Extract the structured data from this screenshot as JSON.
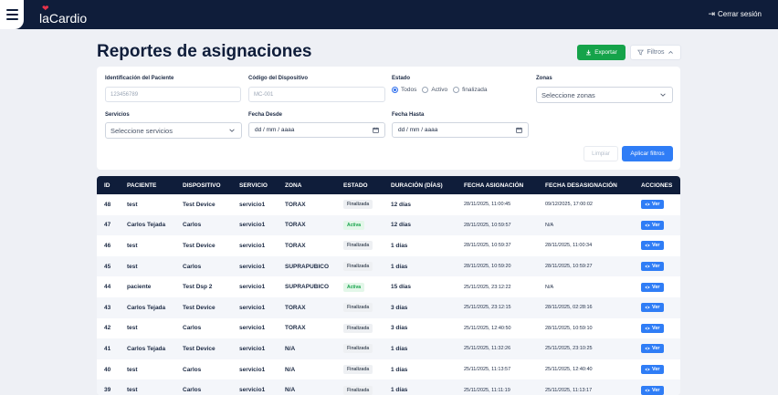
{
  "app": {
    "logo_text": "laCardio",
    "logout_label": "Cerrar sesión"
  },
  "page": {
    "title": "Reportes de asignaciones",
    "export_label": "Exportar",
    "filters_label": "Filtros"
  },
  "filters": {
    "patient_id": {
      "label": "Identificación del Paciente",
      "placeholder": "123456789"
    },
    "device_code": {
      "label": "Código del Dispositivo",
      "placeholder": "MC-001"
    },
    "status": {
      "label": "Estado",
      "options": [
        "Todos",
        "Activo",
        "finalizada"
      ],
      "selected": "Todos"
    },
    "zones": {
      "label": "Zonas",
      "value": "Seleccione zonas"
    },
    "services": {
      "label": "Servicios",
      "value": "Seleccione servicios"
    },
    "date_from": {
      "label": "Fecha Desde",
      "value": "dd / mm / aaaa"
    },
    "date_to": {
      "label": "Fecha Hasta",
      "value": "dd / mm / aaaa"
    },
    "clear_label": "Limpiar",
    "apply_label": "Aplicar filtros"
  },
  "table": {
    "headers": [
      "ID",
      "PACIENTE",
      "DISPOSITIVO",
      "SERVICIO",
      "ZONA",
      "ESTADO",
      "DURACIÓN (DÍAS)",
      "FECHA ASIGNACIÓN",
      "FECHA DESASIGNACIÓN",
      "ACCIONES"
    ],
    "action_label": "Ver",
    "rows": [
      {
        "id": "48",
        "patient": "test",
        "device": "Test Device",
        "service": "servicio1",
        "zone": "TORAX",
        "status": "Finalizada",
        "duration": "12 días",
        "assigned": "28/11/2025, 11:00:45",
        "unassigned": "09/12/2025, 17:00:02"
      },
      {
        "id": "47",
        "patient": "Carlos Tejada",
        "device": "Carlos",
        "service": "servicio1",
        "zone": "TORAX",
        "status": "Activa",
        "duration": "12 días",
        "assigned": "28/11/2025, 10:59:57",
        "unassigned": "N/A"
      },
      {
        "id": "46",
        "patient": "test",
        "device": "Test Device",
        "service": "servicio1",
        "zone": "TORAX",
        "status": "Finalizada",
        "duration": "1 días",
        "assigned": "28/11/2025, 10:59:37",
        "unassigned": "28/11/2025, 11:00:34"
      },
      {
        "id": "45",
        "patient": "test",
        "device": "Carlos",
        "service": "servicio1",
        "zone": "SUPRAPUBICO",
        "status": "Finalizada",
        "duration": "1 días",
        "assigned": "28/11/2025, 10:59:20",
        "unassigned": "28/11/2025, 10:59:27"
      },
      {
        "id": "44",
        "patient": "paciente",
        "device": "Test Dsp 2",
        "service": "servicio1",
        "zone": "SUPRAPUBICO",
        "status": "Activa",
        "duration": "15 días",
        "assigned": "25/11/2025, 23:12:22",
        "unassigned": "N/A"
      },
      {
        "id": "43",
        "patient": "Carlos Tejada",
        "device": "Test Device",
        "service": "servicio1",
        "zone": "TORAX",
        "status": "Finalizada",
        "duration": "3 días",
        "assigned": "25/11/2025, 23:12:15",
        "unassigned": "28/11/2025, 02:28:16"
      },
      {
        "id": "42",
        "patient": "test",
        "device": "Carlos",
        "service": "servicio1",
        "zone": "TORAX",
        "status": "Finalizada",
        "duration": "3 días",
        "assigned": "25/11/2025, 12:40:50",
        "unassigned": "28/11/2025, 10:59:10"
      },
      {
        "id": "41",
        "patient": "Carlos Tejada",
        "device": "Test Device",
        "service": "servicio1",
        "zone": "N/A",
        "status": "Finalizada",
        "duration": "1 días",
        "assigned": "25/11/2025, 11:32:26",
        "unassigned": "25/11/2025, 23:10:25"
      },
      {
        "id": "40",
        "patient": "test",
        "device": "Carlos",
        "service": "servicio1",
        "zone": "N/A",
        "status": "Finalizada",
        "duration": "1 días",
        "assigned": "25/11/2025, 11:13:57",
        "unassigned": "25/11/2025, 12:40:40"
      },
      {
        "id": "39",
        "patient": "test",
        "device": "Carlos",
        "service": "servicio1",
        "zone": "N/A",
        "status": "Finalizada",
        "duration": "1 días",
        "assigned": "25/11/2025, 11:11:19",
        "unassigned": "25/11/2025, 11:13:17"
      }
    ]
  },
  "colors": {
    "navy": "#0f1d3a",
    "export_green": "#15a34a",
    "primary_blue": "#2f7df6",
    "brand_red": "#e8334a"
  },
  "icons": {
    "menu": "hamburger-icon",
    "logout": "logout-icon",
    "export": "download-icon",
    "filters": "filter-icon",
    "view": "eye-icon",
    "date": "calendar-icon"
  }
}
